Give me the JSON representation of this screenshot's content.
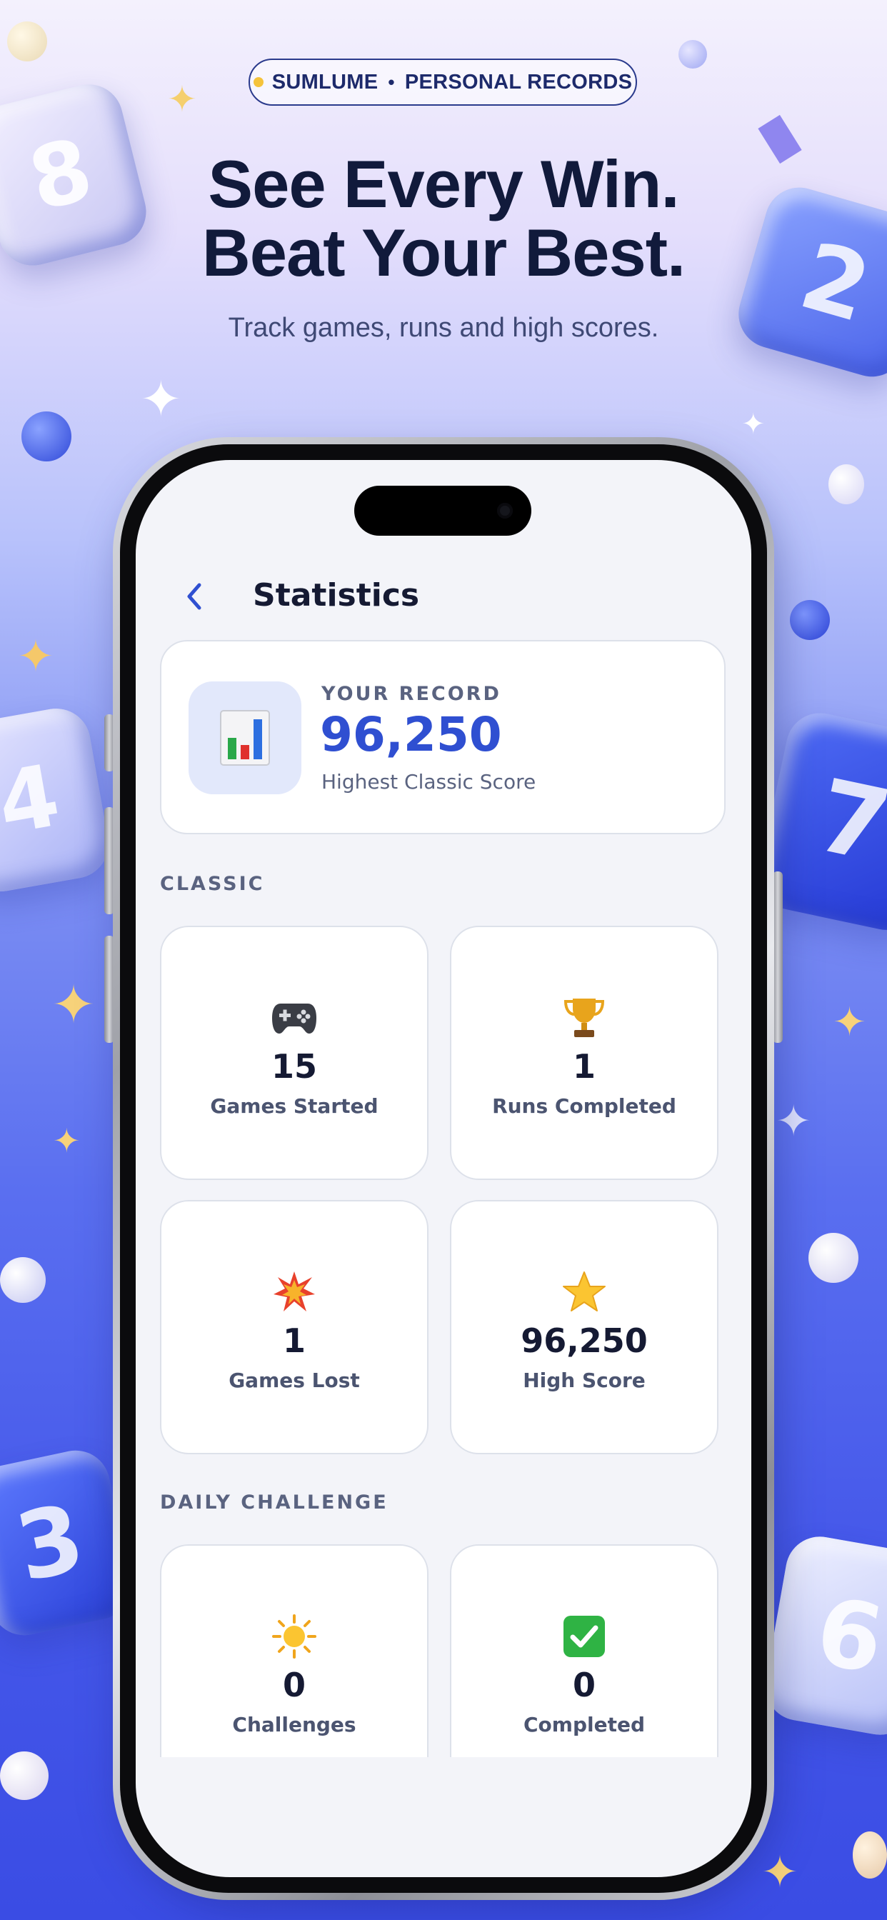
{
  "header": {
    "pill_brand": "SUMLUME",
    "pill_separator": "•",
    "pill_section": "PERSONAL RECORDS",
    "headline_line1": "See Every Win.",
    "headline_line2": "Beat Your Best.",
    "subhead": "Track games, runs and high scores."
  },
  "background_tiles": [
    "8",
    "2",
    "4",
    "7",
    "3",
    "6"
  ],
  "screen": {
    "title": "Statistics",
    "back_icon": "chevron-left-icon",
    "record": {
      "icon": "bar-chart-icon",
      "label": "YOUR RECORD",
      "value": "96,250",
      "caption": "Highest Classic Score"
    },
    "classic": {
      "title": "CLASSIC",
      "stats": [
        {
          "icon": "game-controller-icon",
          "value": "15",
          "label": "Games Started"
        },
        {
          "icon": "trophy-icon",
          "value": "1",
          "label": "Runs Completed"
        },
        {
          "icon": "collision-icon",
          "value": "1",
          "label": "Games Lost"
        },
        {
          "icon": "star-icon",
          "value": "96,250",
          "label": "High Score"
        }
      ]
    },
    "daily": {
      "title": "DAILY CHALLENGE",
      "stats": [
        {
          "icon": "sun-icon",
          "value": "0",
          "label": "Challenges"
        },
        {
          "icon": "check-mark-icon",
          "value": "0",
          "label": "Completed"
        }
      ]
    }
  },
  "colors": {
    "accent": "#2f4fd1",
    "card_bg": "#ffffff",
    "screen_bg": "#f3f4f9",
    "headline": "#111a3b",
    "badge_dot": "#f5c33b"
  }
}
